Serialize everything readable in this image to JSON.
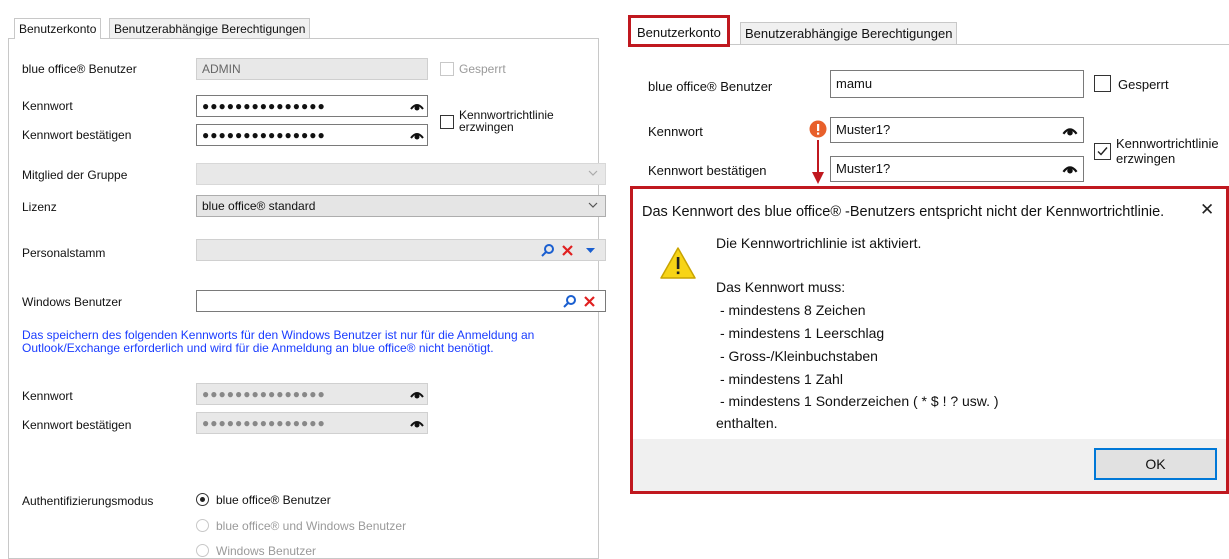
{
  "left": {
    "tabs": [
      "Benutzerkonto",
      "Benutzerabhängige Berechtigungen"
    ],
    "user_label": "blue office® Benutzer",
    "user_value": "ADMIN",
    "locked_label": "Gesperrt",
    "password_label": "Kennwort",
    "password_value": "●●●●●●●●●●●●●●●",
    "confirm_label": "Kennwort bestätigen",
    "confirm_value": "●●●●●●●●●●●●●●●",
    "policy_label": "Kennwortrichtlinie erzwingen",
    "group_label": "Mitglied der Gruppe",
    "group_value": "",
    "license_label": "Lizenz",
    "license_value": "blue office® standard",
    "personnel_label": "Personalstamm",
    "windows_user_label": "Windows Benutzer",
    "note": "Das speichern des folgenden Kennworts für den Windows Benutzer ist nur für die Anmeldung an Outlook/Exchange erforderlich und wird für die Anmeldung an blue office® nicht benötigt.",
    "win_password_label": "Kennwort",
    "win_password_value": "●●●●●●●●●●●●●●●",
    "win_confirm_label": "Kennwort bestätigen",
    "win_confirm_value": "●●●●●●●●●●●●●●●",
    "auth_label": "Authentifizierungsmodus",
    "auth_options": [
      "blue office® Benutzer",
      "blue office® und Windows Benutzer",
      "Windows Benutzer"
    ]
  },
  "right": {
    "tabs": [
      "Benutzerkonto",
      "Benutzerabhängige Berechtigungen"
    ],
    "user_label": "blue office® Benutzer",
    "user_value": "mamu",
    "locked_label": "Gesperrt",
    "password_label": "Kennwort",
    "password_value": "Muster1?",
    "confirm_label": "Kennwort bestätigen",
    "confirm_value": "Muster1?",
    "policy_label": "Kennwortrichtlinie erzwingen"
  },
  "dialog": {
    "title": "Das Kennwort des blue office® -Benutzers entspricht nicht der Kennwortrichtlinie.",
    "line1": "Die Kennwortrichlinie ist aktiviert.",
    "line2": "Das Kennwort muss:",
    "rules": [
      "- mindestens 8 Zeichen",
      "- mindestens 1 Leerschlag",
      "- Gross-/Kleinbuchstaben",
      "- mindestens 1 Zahl",
      "- mindestens 1 Sonderzeichen ( * $ ! ? usw. )"
    ],
    "line_end": "enthalten.",
    "ok": "OK",
    "close": "✕"
  },
  "colors": {
    "highlight": "#c0181f",
    "note": "#1a3cff",
    "ok_border": "#0078d7"
  }
}
